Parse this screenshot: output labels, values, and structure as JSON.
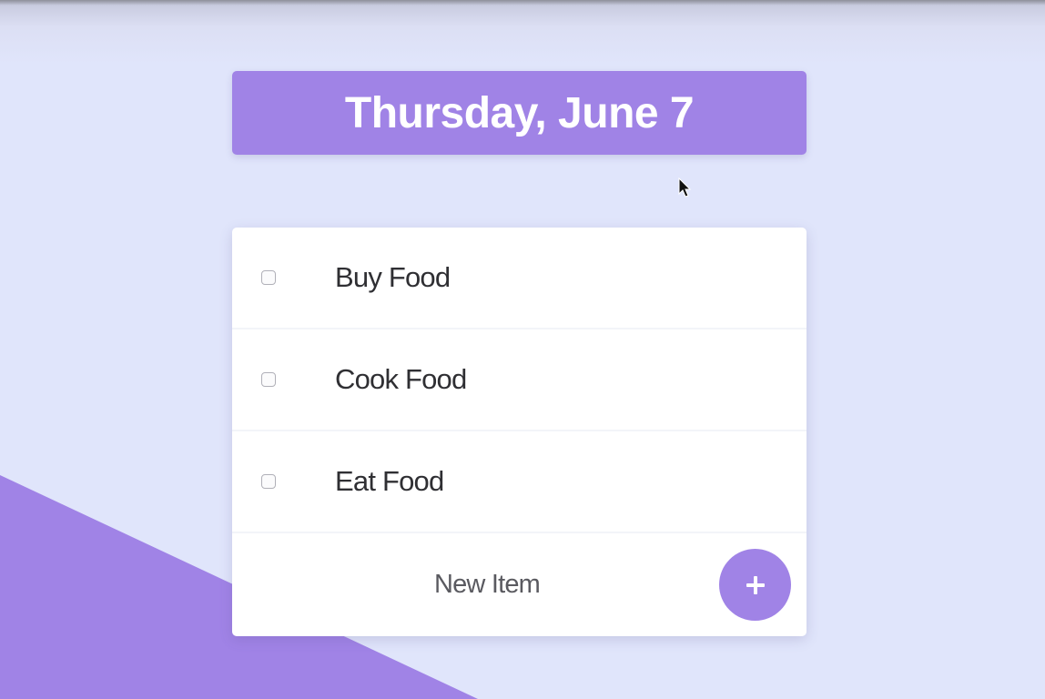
{
  "header": {
    "date_title": "Thursday, June 7"
  },
  "todo_list": {
    "items": [
      {
        "label": "Buy Food",
        "checked": false
      },
      {
        "label": "Cook Food",
        "checked": false
      },
      {
        "label": "Eat Food",
        "checked": false
      }
    ],
    "new_item": {
      "placeholder": "New Item",
      "value": ""
    },
    "add_button_icon": "plus-icon"
  },
  "colors": {
    "accent": "#a083e6",
    "background": "#e0e5fb",
    "card": "#ffffff",
    "text": "#2f2f33"
  }
}
